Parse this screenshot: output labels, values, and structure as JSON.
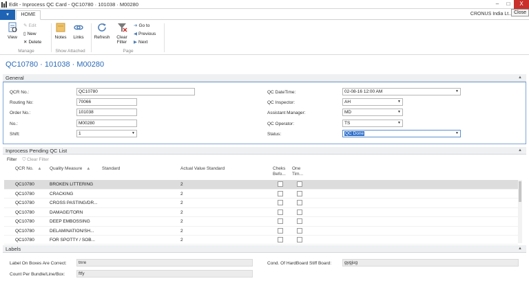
{
  "window": {
    "title": "Edit - Inprocess QC Card - QC10780 · 101038 · M00280",
    "controls": {
      "minimize": "–",
      "maximize": "□",
      "close": "X"
    },
    "close_tooltip": "Close"
  },
  "menu_button": "▾",
  "tab_home": "HOME",
  "company": "CRONUS India Lt...",
  "ribbon": {
    "manage": {
      "label": "Manage",
      "view": "View",
      "edit": "Edit",
      "new": "New",
      "delete": "Delete"
    },
    "show_attached": {
      "label": "Show Attached",
      "notes": "Notes",
      "links": "Links"
    },
    "page": {
      "label": "Page",
      "refresh": "Refresh",
      "clear_filter": "Clear Filter",
      "go_to": "Go to",
      "previous": "Previous",
      "next": "Next"
    }
  },
  "page_title": "QC10780 · 101038 · M00280",
  "general": {
    "header": "General",
    "qcr_no": {
      "label": "QCR No.:",
      "value": "QC10780"
    },
    "routing_no": {
      "label": "Routing No:",
      "value": "70066"
    },
    "order_no": {
      "label": "Order No.:",
      "value": "101038"
    },
    "no": {
      "label": "No.:",
      "value": "M00280"
    },
    "shift": {
      "label": "Shift:",
      "value": "1"
    },
    "qc_datetime": {
      "label": "QC DateTime:",
      "value": "02-08-16 12:00 AM"
    },
    "qc_inspector": {
      "label": "QC Inspector:",
      "value": "AH"
    },
    "assistant_manager": {
      "label": "Assistant Manager:",
      "value": "MD"
    },
    "qc_operator": {
      "label": "QC Operator:",
      "value": "TS"
    },
    "status": {
      "label": "Status:",
      "value": "QC Done"
    }
  },
  "list": {
    "header": "Inprocess Pending QC List",
    "filter": "Filter",
    "clear_filter": "Clear Filter",
    "columns": {
      "qcr_no": "QCR No.",
      "quality_measure": "Quality Measure",
      "standard": "Standard",
      "actual_value_standard": "Actual Value Standard",
      "cheks_before": "Cheks Befo...",
      "one_time": "One Tim..."
    },
    "rows": [
      {
        "qcr_no": "QC10780",
        "measure": "BROKEN LITTERING",
        "actual": "2"
      },
      {
        "qcr_no": "QC10780",
        "measure": "CRACKING",
        "actual": "2"
      },
      {
        "qcr_no": "QC10780",
        "measure": "CROSS PASTING/DR...",
        "actual": "2"
      },
      {
        "qcr_no": "QC10780",
        "measure": "DAMAGE/TORN",
        "actual": "2"
      },
      {
        "qcr_no": "QC10780",
        "measure": "DEEP EMBOSSING",
        "actual": "2"
      },
      {
        "qcr_no": "QC10780",
        "measure": "DELAMINATION/SH...",
        "actual": "2"
      },
      {
        "qcr_no": "QC10780",
        "measure": "FOR SPOTTY / SOB...",
        "actual": "2"
      }
    ]
  },
  "labels": {
    "header": "Labels",
    "label_on_boxes": {
      "label": "Label On Boxes Are Correct:",
      "value": "tnre"
    },
    "count_per_bundle": {
      "label": "Count Per Bundle/Line/Box:",
      "value": "ftfy"
    },
    "cond_hardboard": {
      "label": "Cond. Of HardBoard Stiff Board:",
      "value": "gygjug"
    }
  },
  "colors": {
    "accent": "#1e63b4",
    "title_blue": "#2a6ab7",
    "focus_border": "#7ea6d6",
    "close_red": "#c9302c"
  }
}
